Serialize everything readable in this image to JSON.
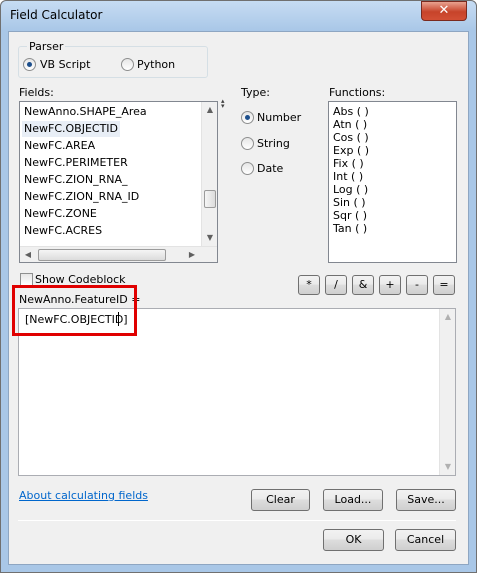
{
  "window": {
    "title": "Field Calculator",
    "close_glyph": "✕"
  },
  "parser": {
    "legend": "Parser",
    "options": [
      {
        "label": "VB Script",
        "selected": true
      },
      {
        "label": "Python",
        "selected": false
      }
    ]
  },
  "fields": {
    "label": "Fields:",
    "items": [
      "NewAnno.SHAPE_Area",
      "NewFC.OBJECTID",
      "NewFC.AREA",
      "NewFC.PERIMETER",
      "NewFC.ZION_RNA_",
      "NewFC.ZION_RNA_ID",
      "NewFC.ZONE",
      "NewFC.ACRES"
    ],
    "selected_index": 1
  },
  "type": {
    "label": "Type:",
    "options": [
      {
        "label": "Number",
        "selected": true
      },
      {
        "label": "String",
        "selected": false
      },
      {
        "label": "Date",
        "selected": false
      }
    ]
  },
  "functions": {
    "label": "Functions:",
    "items": [
      "Abs ( )",
      "Atn ( )",
      "Cos ( )",
      "Exp ( )",
      "Fix ( )",
      "Int ( )",
      "Log ( )",
      "Sin ( )",
      "Sqr ( )",
      "Tan ( )"
    ]
  },
  "show_codeblock": {
    "label": "Show Codeblock",
    "checked": false
  },
  "operators": [
    "*",
    "/",
    "&",
    "+",
    "-",
    "="
  ],
  "expression": {
    "label": "NewAnno.FeatureID =",
    "value": "[NewFC.OBJECTID]"
  },
  "highlight_color": "#e00000",
  "link": {
    "label": "About calculating fields"
  },
  "buttons": {
    "clear": "Clear",
    "load": "Load...",
    "save": "Save...",
    "ok": "OK",
    "cancel": "Cancel"
  },
  "icons": {
    "close": "close-icon",
    "scroll_up": "arrow-up-icon",
    "scroll_down": "arrow-down-icon",
    "scroll_left": "arrow-left-icon",
    "scroll_right": "arrow-right-icon",
    "sort": "sort-arrows-icon"
  }
}
